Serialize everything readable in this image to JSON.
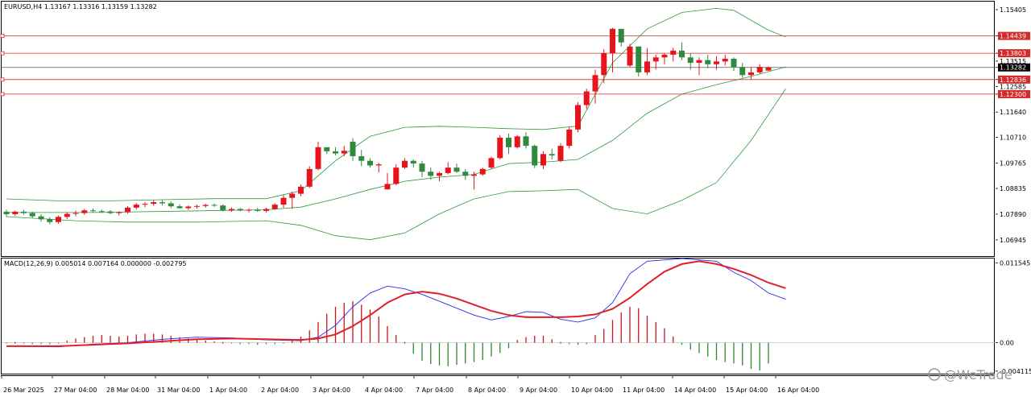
{
  "price_panel": {
    "header": "EURUSD,H4  1.13167 1.13316 1.13159 1.13282"
  },
  "macd_panel": {
    "header": "MACD(12,26,9) 0.005014 0.007164 0.000000 -0.002795"
  },
  "watermark": "@WeTrade",
  "colors": {
    "bull_candle": "#e8141c",
    "bear_candle": "#2f8a3f",
    "bands": "#2a9a3a",
    "hline": "#d42a2a",
    "macd_line": "#2a2ae8",
    "signal_line": "#e0202a",
    "hist_pos": "#c8141c",
    "hist_neg": "#2a8a2a"
  },
  "chart_data": [
    {
      "type": "candlestick",
      "symbol": "EURUSD",
      "timeframe": "H4",
      "ohlc_last": [
        1.13167,
        1.13316,
        1.13159,
        1.13282
      ],
      "y_ticks": [
        "1.15405",
        "1.14439",
        "1.13803",
        "1.13515",
        "1.13282",
        "1.12836",
        "1.12585",
        "1.12300",
        "1.11640",
        "1.10710",
        "1.09765",
        "1.08835",
        "1.07890",
        "1.06945"
      ],
      "highlighted_levels": [
        {
          "value": 1.14439,
          "label": "1.14439"
        },
        {
          "value": 1.13803,
          "label": "1.13803"
        },
        {
          "value": 1.12836,
          "label": "1.12836"
        },
        {
          "value": 1.123,
          "label": "1.12300"
        }
      ],
      "current_price": {
        "value": 1.13282,
        "label": "1.13282"
      },
      "x_ticks": [
        "26 Mar 2025",
        "27 Mar 04:00",
        "28 Mar 04:00",
        "31 Mar 04:00",
        "1 Apr 04:00",
        "2 Apr 04:00",
        "3 Apr 04:00",
        "4 Apr 04:00",
        "7 Apr 04:00",
        "8 Apr 04:00",
        "9 Apr 04:00",
        "10 Apr 04:00",
        "11 Apr 04:00",
        "14 Apr 04:00",
        "15 Apr 04:00",
        "16 Apr 04:00"
      ],
      "candles": [
        [
          1.0798,
          1.0806,
          1.0779,
          1.0789
        ],
        [
          1.0789,
          1.0802,
          1.0782,
          1.0798
        ],
        [
          1.0798,
          1.0804,
          1.0787,
          1.0793
        ],
        [
          1.0793,
          1.0798,
          1.0775,
          1.0781
        ],
        [
          1.0781,
          1.0789,
          1.0762,
          1.077
        ],
        [
          1.077,
          1.0778,
          1.0752,
          1.076
        ],
        [
          1.076,
          1.0784,
          1.0754,
          1.0779
        ],
        [
          1.0779,
          1.0796,
          1.0771,
          1.079
        ],
        [
          1.079,
          1.0802,
          1.0781,
          1.0793
        ],
        [
          1.0793,
          1.0808,
          1.0787,
          1.0803
        ],
        [
          1.0803,
          1.081,
          1.0795,
          1.08
        ],
        [
          1.08,
          1.0806,
          1.0793,
          1.0799
        ],
        [
          1.0799,
          1.0804,
          1.0789,
          1.0793
        ],
        [
          1.0793,
          1.08,
          1.0785,
          1.0796
        ],
        [
          1.0796,
          1.0818,
          1.0791,
          1.0813
        ],
        [
          1.0813,
          1.083,
          1.0806,
          1.0824
        ],
        [
          1.0824,
          1.0834,
          1.0814,
          1.0827
        ],
        [
          1.0827,
          1.084,
          1.082,
          1.0833
        ],
        [
          1.0833,
          1.0841,
          1.0822,
          1.0829
        ],
        [
          1.0829,
          1.0836,
          1.0811,
          1.0818
        ],
        [
          1.0818,
          1.0826,
          1.0809,
          1.0811
        ],
        [
          1.0811,
          1.0821,
          1.0805,
          1.0817
        ],
        [
          1.0817,
          1.0824,
          1.081,
          1.0819
        ],
        [
          1.0819,
          1.0827,
          1.0813,
          1.0823
        ],
        [
          1.0823,
          1.0828,
          1.0816,
          1.0821
        ],
        [
          1.0821,
          1.0825,
          1.0799,
          1.0803
        ],
        [
          1.0803,
          1.0814,
          1.0798,
          1.0808
        ],
        [
          1.0808,
          1.0812,
          1.0799,
          1.0803
        ],
        [
          1.0803,
          1.081,
          1.0796,
          1.0805
        ],
        [
          1.0805,
          1.0812,
          1.0797,
          1.0801
        ],
        [
          1.0801,
          1.0813,
          1.0796,
          1.0808
        ],
        [
          1.0808,
          1.0829,
          1.0805,
          1.0824
        ],
        [
          1.0824,
          1.0859,
          1.0812,
          1.0849
        ],
        [
          1.0849,
          1.0872,
          1.0808,
          1.0864
        ],
        [
          1.0864,
          1.0898,
          1.0855,
          1.089
        ],
        [
          1.089,
          1.0965,
          1.0885,
          1.0955
        ],
        [
          1.0955,
          1.1055,
          1.095,
          1.1035
        ],
        [
          1.1035,
          1.103,
          1.101,
          1.102
        ],
        [
          1.102,
          1.1035,
          1.1005,
          1.1012
        ],
        [
          1.1012,
          1.104,
          1.1002,
          1.1022
        ],
        [
          1.1055,
          1.1068,
          1.0985,
          1.1002
        ],
        [
          1.1002,
          1.1025,
          1.0965,
          1.0985
        ],
        [
          1.0985,
          1.0994,
          1.096,
          1.0968
        ],
        [
          1.0968,
          1.0978,
          1.0942,
          1.0972
        ],
        [
          1.088,
          1.094,
          1.088,
          1.09
        ],
        [
          1.09,
          1.0972,
          1.0895,
          1.096
        ],
        [
          1.096,
          1.0995,
          1.0955,
          1.0985
        ],
        [
          1.0985,
          1.099,
          1.096,
          1.0975
        ],
        [
          1.0975,
          1.0985,
          1.0925,
          1.0945
        ],
        [
          1.0945,
          1.096,
          1.0915,
          1.093
        ],
        [
          1.093,
          1.0945,
          1.091,
          1.094
        ],
        [
          1.094,
          1.098,
          1.0935,
          1.096
        ],
        [
          1.096,
          1.0975,
          1.094,
          1.0945
        ],
        [
          1.0945,
          1.0955,
          1.0915,
          1.093
        ],
        [
          1.093,
          1.0945,
          1.088,
          1.0935
        ],
        [
          1.0935,
          1.096,
          1.093,
          1.0955
        ],
        [
          1.096,
          1.1,
          1.0955,
          1.0995
        ],
        [
          1.0995,
          1.108,
          1.099,
          1.107
        ],
        [
          1.107,
          1.1085,
          1.101,
          1.1035
        ],
        [
          1.1035,
          1.108,
          1.103,
          1.1075
        ],
        [
          1.1075,
          1.109,
          1.103,
          1.104
        ],
        [
          1.104,
          1.1045,
          1.0958,
          1.0968
        ],
        [
          1.0968,
          1.102,
          1.0955,
          1.101
        ],
        [
          1.101,
          1.103,
          1.099,
          1.1005
        ],
        [
          1.0985,
          1.105,
          1.098,
          1.104
        ],
        [
          1.104,
          1.111,
          1.103,
          1.11
        ],
        [
          1.11,
          1.12,
          1.109,
          1.119
        ],
        [
          1.119,
          1.125,
          1.1175,
          1.124
        ],
        [
          1.124,
          1.132,
          1.1195,
          1.13
        ],
        [
          1.13,
          1.1395,
          1.127,
          1.138
        ],
        [
          1.138,
          1.1474,
          1.131,
          1.147
        ],
        [
          1.147,
          1.1465,
          1.1405,
          1.142
        ],
        [
          1.1335,
          1.1415,
          1.133,
          1.1405
        ],
        [
          1.1405,
          1.1375,
          1.1295,
          1.131
        ],
        [
          1.131,
          1.14,
          1.13,
          1.135
        ],
        [
          1.135,
          1.1375,
          1.132,
          1.1365
        ],
        [
          1.1365,
          1.138,
          1.134,
          1.1375
        ],
        [
          1.1375,
          1.14,
          1.135,
          1.139
        ],
        [
          1.139,
          1.142,
          1.1355,
          1.1365
        ],
        [
          1.1365,
          1.138,
          1.132,
          1.1345
        ],
        [
          1.1345,
          1.1365,
          1.13,
          1.1355
        ],
        [
          1.1355,
          1.1375,
          1.1325,
          1.134
        ],
        [
          1.134,
          1.137,
          1.132,
          1.135
        ],
        [
          1.135,
          1.1375,
          1.1335,
          1.136
        ],
        [
          1.136,
          1.1365,
          1.1315,
          1.133
        ],
        [
          1.133,
          1.1345,
          1.129,
          1.13
        ],
        [
          1.13,
          1.133,
          1.1285,
          1.131
        ],
        [
          1.131,
          1.134,
          1.1305,
          1.133
        ],
        [
          1.13167,
          1.13316,
          1.13159,
          1.13282
        ]
      ],
      "bollinger": {
        "upper": [
          [
            0,
            1.0845
          ],
          [
            6,
            1.0838
          ],
          [
            12,
            1.0838
          ],
          [
            18,
            1.0842
          ],
          [
            24,
            1.0846
          ],
          [
            30,
            1.0846
          ],
          [
            34,
            1.0875
          ],
          [
            38,
            1.0985
          ],
          [
            42,
            1.1075
          ],
          [
            46,
            1.1108
          ],
          [
            50,
            1.1112
          ],
          [
            54,
            1.1108
          ],
          [
            58,
            1.1103
          ],
          [
            62,
            1.11
          ],
          [
            66,
            1.1113
          ],
          [
            70,
            1.1345
          ],
          [
            74,
            1.147
          ],
          [
            78,
            1.153
          ],
          [
            82,
            1.1545
          ],
          [
            84,
            1.1538
          ],
          [
            88,
            1.1465
          ],
          [
            90,
            1.144
          ]
        ],
        "middle": [
          [
            0,
            1.0795
          ],
          [
            10,
            1.0795
          ],
          [
            20,
            1.08
          ],
          [
            30,
            1.0805
          ],
          [
            34,
            1.0815
          ],
          [
            38,
            1.0845
          ],
          [
            42,
            1.088
          ],
          [
            46,
            1.091
          ],
          [
            50,
            1.0925
          ],
          [
            54,
            1.0935
          ],
          [
            58,
            1.0975
          ],
          [
            62,
            1.098
          ],
          [
            66,
            1.099
          ],
          [
            70,
            1.106
          ],
          [
            74,
            1.116
          ],
          [
            78,
            1.123
          ],
          [
            82,
            1.1265
          ],
          [
            86,
            1.1295
          ],
          [
            90,
            1.133
          ]
        ],
        "lower": [
          [
            0,
            1.078
          ],
          [
            8,
            1.0765
          ],
          [
            14,
            1.076
          ],
          [
            22,
            1.076
          ],
          [
            30,
            1.0765
          ],
          [
            34,
            1.0748
          ],
          [
            38,
            1.071
          ],
          [
            42,
            1.0695
          ],
          [
            46,
            1.072
          ],
          [
            50,
            1.079
          ],
          [
            54,
            1.0845
          ],
          [
            58,
            1.0872
          ],
          [
            62,
            1.0875
          ],
          [
            66,
            1.088
          ],
          [
            70,
            1.081
          ],
          [
            74,
            1.079
          ],
          [
            78,
            1.084
          ],
          [
            82,
            1.0905
          ],
          [
            86,
            1.106
          ],
          [
            90,
            1.125
          ]
        ]
      }
    },
    {
      "type": "macd",
      "params": "12,26,9",
      "values_shown": {
        "macd": 0.005014,
        "signal": 0.007164,
        "hist_a": 0.0,
        "hist_b": -0.002795
      },
      "y_ticks": [
        "0.011545",
        "0.00",
        "-0.004115"
      ],
      "histogram": [
        0.0,
        0.0001,
        0.0,
        -0.0001,
        -0.0002,
        -0.0001,
        0.0,
        0.0003,
        0.0006,
        0.0008,
        0.001,
        0.0011,
        0.001,
        0.0009,
        0.001,
        0.0012,
        0.0013,
        0.0013,
        0.0012,
        0.001,
        0.0008,
        0.0006,
        0.0004,
        0.0003,
        0.0002,
        0.0001,
        0.0,
        -0.0001,
        -0.0002,
        -0.0003,
        -0.0002,
        -0.0001,
        0.0,
        0.0003,
        0.0009,
        0.0018,
        0.003,
        0.0042,
        0.0052,
        0.0058,
        0.006,
        0.0055,
        0.0048,
        0.0038,
        0.0024,
        0.0011,
        0.0001,
        -0.0016,
        -0.0026,
        -0.0031,
        -0.0033,
        -0.0034,
        -0.0032,
        -0.003,
        -0.0028,
        -0.0025,
        -0.002,
        -0.0015,
        -0.0008,
        0.0004,
        0.0008,
        0.001,
        0.001,
        0.0005,
        0.0001,
        -0.0002,
        -0.0003,
        -0.0001,
        0.0011,
        0.002,
        0.0033,
        0.0044,
        0.0052,
        0.005,
        0.0039,
        0.003,
        0.0021,
        0.0009,
        -0.0003,
        -0.001,
        -0.0015,
        -0.002,
        -0.0025,
        -0.0028,
        -0.003,
        -0.0033,
        -0.0038,
        -0.004,
        -0.003
      ],
      "macd_line": [
        [
          0,
          -0.0005
        ],
        [
          6,
          -0.0006
        ],
        [
          10,
          -0.0002
        ],
        [
          14,
          0.0
        ],
        [
          18,
          0.0005
        ],
        [
          22,
          0.0008
        ],
        [
          26,
          0.0007
        ],
        [
          30,
          0.0004
        ],
        [
          34,
          0.0003
        ],
        [
          36,
          0.0008
        ],
        [
          38,
          0.0025
        ],
        [
          40,
          0.0052
        ],
        [
          42,
          0.0072
        ],
        [
          44,
          0.0082
        ],
        [
          46,
          0.0078
        ],
        [
          48,
          0.007
        ],
        [
          50,
          0.006
        ],
        [
          52,
          0.005
        ],
        [
          54,
          0.004
        ],
        [
          56,
          0.0033
        ],
        [
          58,
          0.0038
        ],
        [
          60,
          0.0045
        ],
        [
          62,
          0.0044
        ],
        [
          64,
          0.0034
        ],
        [
          66,
          0.003
        ],
        [
          68,
          0.0036
        ],
        [
          70,
          0.0058
        ],
        [
          72,
          0.01
        ],
        [
          74,
          0.0118
        ],
        [
          78,
          0.0122
        ],
        [
          82,
          0.0118
        ],
        [
          84,
          0.0102
        ],
        [
          86,
          0.009
        ],
        [
          88,
          0.0072
        ],
        [
          90,
          0.0063
        ]
      ],
      "signal_line": [
        [
          0,
          -0.0005
        ],
        [
          6,
          -0.0005
        ],
        [
          10,
          -0.0003
        ],
        [
          14,
          -0.0001
        ],
        [
          18,
          0.0002
        ],
        [
          22,
          0.0005
        ],
        [
          26,
          0.0006
        ],
        [
          30,
          0.0005
        ],
        [
          34,
          0.0004
        ],
        [
          36,
          0.0006
        ],
        [
          38,
          0.0012
        ],
        [
          40,
          0.0024
        ],
        [
          42,
          0.004
        ],
        [
          44,
          0.0058
        ],
        [
          46,
          0.007
        ],
        [
          48,
          0.0074
        ],
        [
          50,
          0.0071
        ],
        [
          52,
          0.0064
        ],
        [
          54,
          0.0055
        ],
        [
          56,
          0.0046
        ],
        [
          58,
          0.004
        ],
        [
          60,
          0.0037
        ],
        [
          62,
          0.0037
        ],
        [
          64,
          0.0037
        ],
        [
          66,
          0.0038
        ],
        [
          68,
          0.0041
        ],
        [
          70,
          0.0049
        ],
        [
          72,
          0.0065
        ],
        [
          74,
          0.0085
        ],
        [
          76,
          0.0103
        ],
        [
          78,
          0.0114
        ],
        [
          80,
          0.0118
        ],
        [
          82,
          0.0114
        ],
        [
          84,
          0.0107
        ],
        [
          86,
          0.0098
        ],
        [
          88,
          0.0087
        ],
        [
          90,
          0.0079
        ]
      ]
    }
  ]
}
